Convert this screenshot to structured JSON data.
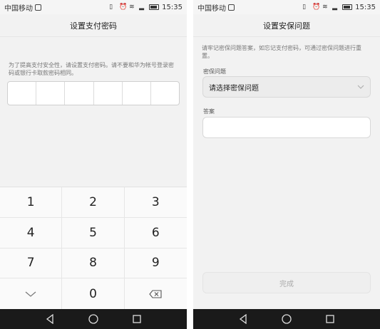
{
  "status_bar": {
    "carrier": "中国移动",
    "time": "15:35"
  },
  "left": {
    "title": "设置支付密码",
    "hint": "为了提高支付安全性，请设置支付密码。请不要和华为帐号登录密码或银行卡取款密码相同。",
    "keys": [
      "1",
      "2",
      "3",
      "4",
      "5",
      "6",
      "7",
      "8",
      "9",
      "",
      "0",
      ""
    ]
  },
  "right": {
    "title": "设置安保问题",
    "hint": "请牢记密保问题答案，如忘记支付密码，可通过密保问题进行重置。",
    "question_label": "密保问题",
    "question_value": "请选择密保问题",
    "answer_label": "答案",
    "done_label": "完成"
  },
  "icons": [
    "sim-icon",
    "vibrate-icon",
    "alarm-icon",
    "wifi-icon",
    "signal-icon",
    "battery-icon",
    "chevron-down-icon",
    "backspace-icon",
    "nav-back-icon",
    "nav-home-icon",
    "nav-recents-icon"
  ]
}
